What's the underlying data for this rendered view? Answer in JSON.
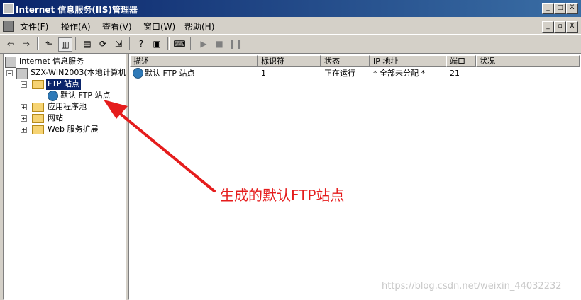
{
  "window": {
    "title": "Internet 信息服务(IIS)管理器"
  },
  "titlebar_buttons": [
    "_",
    "□",
    "X"
  ],
  "menu": [
    "文件(F)",
    "操作(A)",
    "查看(V)",
    "窗口(W)",
    "帮助(H)"
  ],
  "mdi_buttons": [
    "_",
    "▫",
    "X"
  ],
  "toolbar": {
    "icons": [
      "back-arrow-icon",
      "forward-arrow-icon",
      "up-folder-icon",
      "show-tree-icon",
      "properties-icon",
      "refresh-icon",
      "export-icon",
      "help-icon",
      "console-icon",
      "computer-icon",
      "play-icon",
      "stop-icon",
      "pause-icon"
    ]
  },
  "tree": {
    "root": "Internet 信息服务",
    "server": "SZX-WIN2003(本地计算机)",
    "ftp_sites": "FTP 站点",
    "default_ftp": "默认 FTP 站点",
    "app_pools": "应用程序池",
    "websites": "网站",
    "web_ext": "Web 服务扩展"
  },
  "list": {
    "columns": [
      "描述",
      "标识符",
      "状态",
      "IP 地址",
      "端口",
      "状况"
    ],
    "rows": [
      {
        "desc": "默认 FTP 站点",
        "id": "1",
        "status": "正在运行",
        "ip": "* 全部未分配 *",
        "port": "21",
        "condition": ""
      }
    ]
  },
  "annotation": {
    "text": "生成的默认FTP站点",
    "color": "#e51c1c"
  },
  "watermark": "https://blog.csdn.net/weixin_44032232"
}
